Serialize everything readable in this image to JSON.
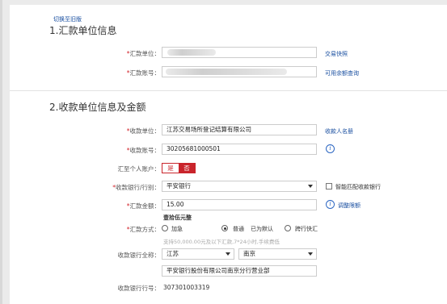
{
  "switch_link": "切换至旧版",
  "section1": {
    "title": "1.汇款单位信息",
    "payer_unit_label": "汇款单位：",
    "payer_account_label": "汇款账号：",
    "quick_trade_link": "交易快照",
    "balance_link": "可用余额查询"
  },
  "section2": {
    "title": "2.收款单位信息及金额",
    "payee_unit_label": "收款单位：",
    "payee_unit_value": "江苏交易场所登记结算有限公司",
    "payee_register_link": "收款人名册",
    "payee_account_label": "收款账号：",
    "payee_account_value": "30205681000501",
    "personal_label": "汇至个人账户：",
    "personal_yes": "是",
    "personal_no": "否",
    "bank_label": "收款银行/行别：",
    "bank_value": "平安银行",
    "smart_match_label": "智能匹配收款银行",
    "amount_label": "汇款金额：",
    "amount_value": "15.00",
    "limit_link": "调整限额",
    "amount_upper": "壹拾伍元整",
    "method_label": "汇款方式：",
    "method_urgent": "加急",
    "method_normal": "普通",
    "method_normal_note": "已为默认",
    "method_crossbank": "跨行快汇",
    "method_hint": "支持50,000.00元及以下汇款,7*24小时,手续费低",
    "bank_fullname_label": "收款银行全称：",
    "province_value": "江苏",
    "city_value": "南京",
    "branch_value": "平安银行股份有限公司南京分行营业部",
    "bank_code_label": "收款银行行号：",
    "bank_code_value": "307301003319"
  },
  "colors": {
    "accent_red": "#c9242b",
    "link_blue": "#1a4fa0"
  }
}
